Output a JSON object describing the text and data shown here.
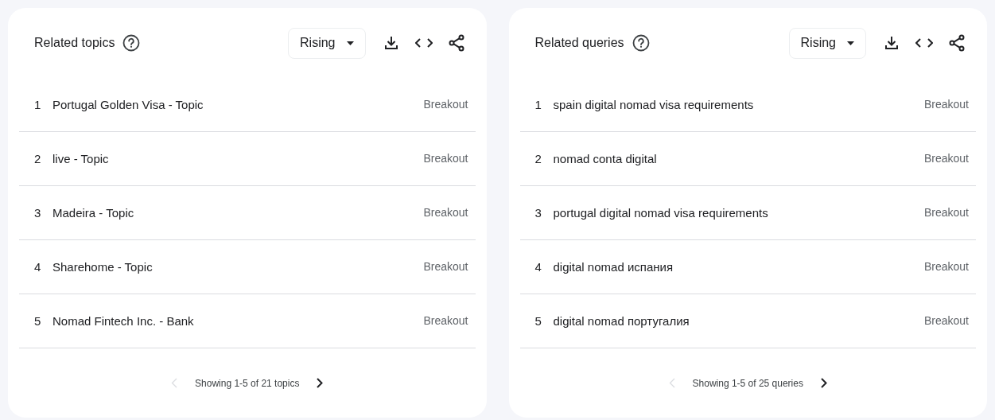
{
  "panels": [
    {
      "title": "Related topics",
      "filter": "Rising",
      "rows": [
        {
          "rank": "1",
          "label": "Portugal Golden Visa - Topic",
          "value": "Breakout"
        },
        {
          "rank": "2",
          "label": "live - Topic",
          "value": "Breakout"
        },
        {
          "rank": "3",
          "label": "Madeira - Topic",
          "value": "Breakout"
        },
        {
          "rank": "4",
          "label": "Sharehome - Topic",
          "value": "Breakout"
        },
        {
          "rank": "5",
          "label": "Nomad Fintech Inc. - Bank",
          "value": "Breakout"
        }
      ],
      "pagination": {
        "text": "Showing 1-5 of 21 topics",
        "prev_disabled": true,
        "next_disabled": false
      }
    },
    {
      "title": "Related queries",
      "filter": "Rising",
      "rows": [
        {
          "rank": "1",
          "label": "spain digital nomad visa requirements",
          "value": "Breakout"
        },
        {
          "rank": "2",
          "label": "nomad conta digital",
          "value": "Breakout"
        },
        {
          "rank": "3",
          "label": "portugal digital nomad visa requirements",
          "value": "Breakout"
        },
        {
          "rank": "4",
          "label": "digital nomad испания",
          "value": "Breakout"
        },
        {
          "rank": "5",
          "label": "digital nomad португалия",
          "value": "Breakout"
        }
      ],
      "pagination": {
        "text": "Showing 1-5 of 25 queries",
        "prev_disabled": true,
        "next_disabled": false
      }
    }
  ]
}
